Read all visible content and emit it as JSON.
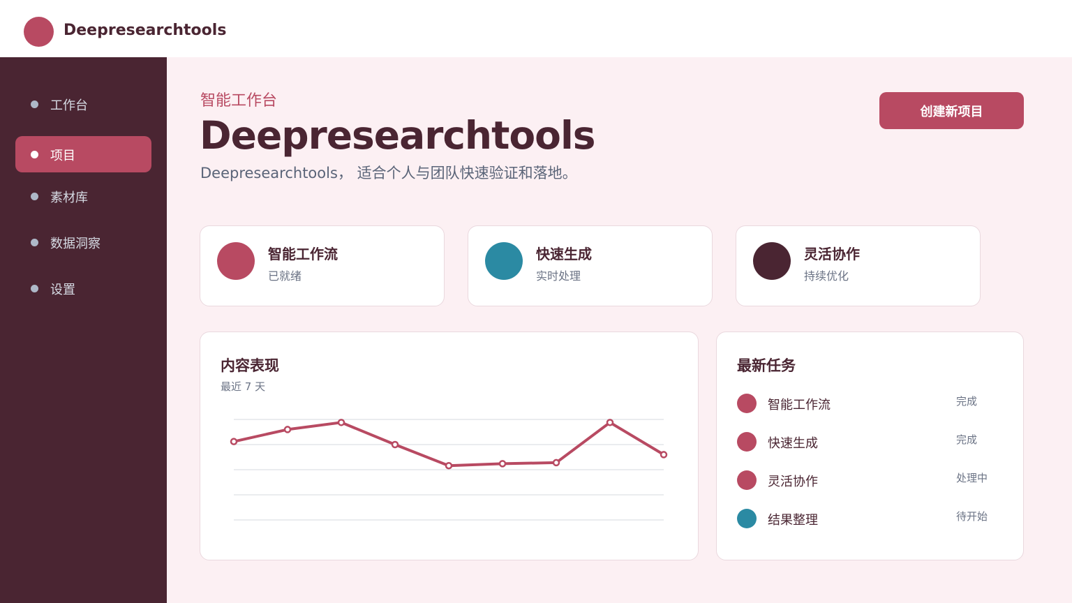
{
  "app": {
    "brand": "Deepresearchtools"
  },
  "sidebar": {
    "items": [
      {
        "label": "工作台",
        "active": false
      },
      {
        "label": "项目",
        "active": true
      },
      {
        "label": "素材库",
        "active": false
      },
      {
        "label": "数据洞察",
        "active": false
      },
      {
        "label": "设置",
        "active": false
      }
    ]
  },
  "hero": {
    "eyebrow": "智能工作台",
    "title": "Deepresearchtools",
    "subtitle": "Deepresearchtools， 适合个人与团队快速验证和落地。",
    "cta_label": "创建新项目"
  },
  "features": [
    {
      "title": "智能工作流",
      "subtitle": "已就绪",
      "color": "#b84a62"
    },
    {
      "title": "快速生成",
      "subtitle": "实时处理",
      "color": "#2b8aa3"
    },
    {
      "title": "灵活协作",
      "subtitle": "持续优化",
      "color": "#4a2532"
    }
  ],
  "performance": {
    "title": "内容表现",
    "subtitle": "最近 7 天"
  },
  "chart_data": {
    "type": "line",
    "title": "内容表现",
    "subtitle": "最近 7 天",
    "xlabel": "",
    "ylabel": "",
    "grid": true,
    "ylim": [
      0,
      100
    ],
    "x": [
      1,
      2,
      3,
      4,
      5,
      6,
      7,
      8,
      9
    ],
    "series": [
      {
        "values": [
          78,
          90,
          97,
          75,
          54,
          56,
          57,
          97,
          65
        ],
        "color": "#b84a62"
      }
    ]
  },
  "tasks": {
    "title": "最新任务",
    "items": [
      {
        "name": "智能工作流",
        "status": "完成",
        "color": "#b84a62"
      },
      {
        "name": "快速生成",
        "status": "完成",
        "color": "#b84a62"
      },
      {
        "name": "灵活协作",
        "status": "处理中",
        "color": "#b84a62"
      },
      {
        "name": "结果整理",
        "status": "待开始",
        "color": "#2b8aa3"
      }
    ]
  },
  "colors": {
    "accent": "#b84a62",
    "dark": "#4a2532",
    "teal": "#2b8aa3",
    "background": "#fcf0f3"
  }
}
